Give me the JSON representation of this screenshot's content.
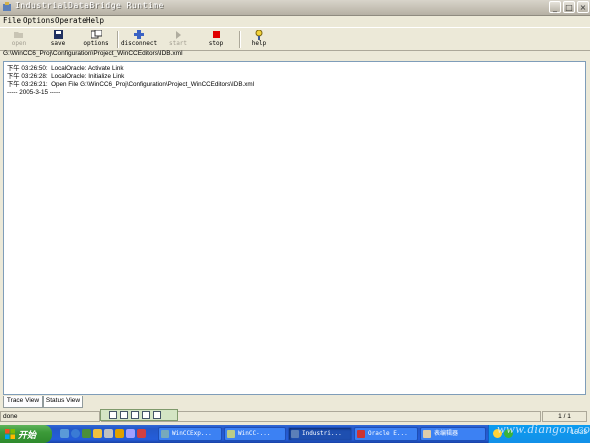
{
  "window": {
    "title": "IndustrialDataBridge Runtime",
    "controls": {
      "minimize": "_",
      "maximize": "□",
      "close": "×"
    }
  },
  "menu": [
    "File",
    "Options",
    "Operate",
    "Help"
  ],
  "toolbar": [
    {
      "label": "open",
      "icon": "open-folder-icon",
      "enabled": false
    },
    {
      "label": "save",
      "icon": "floppy-disk-icon",
      "enabled": true
    },
    {
      "label": "options",
      "icon": "options-window-icon",
      "enabled": true
    },
    {
      "label": "disconnect",
      "icon": "disconnect-plug-icon",
      "enabled": true
    },
    {
      "label": "start",
      "icon": "play-arrow-icon",
      "enabled": false
    },
    {
      "label": "stop",
      "icon": "red-stop-square-icon",
      "enabled": true
    },
    {
      "label": "help",
      "icon": "help-question-icon",
      "enabled": true
    }
  ],
  "file_path": "G:\\WinCC6_Proj\\Configuration\\Project_WinCCEditors\\IDB.xml",
  "log": [
    "下午 03:26:50:  LocalOracle: Activate Link",
    "下午 03:26:28:  LocalOracle: Initialize Link",
    "下午 03:26:21:  Open File G:\\WinCC6_Proj\\Configuration\\Project_WinCCEditors\\IDB.xml",
    "----- 2005-3-15 -----"
  ],
  "tabs": [
    "Trace View",
    "Status View"
  ],
  "status": {
    "left": "done",
    "page": "1 / 1"
  },
  "taskbar": {
    "start": "开始",
    "tasks": [
      "WinCCExp...",
      "WinCC-...",
      "Industri...",
      "Oracle E...",
      "表编辑器"
    ],
    "clock": "15:33"
  },
  "watermark": "www.diangon.com",
  "colors": {
    "taskbar": "#245dda",
    "start": "#3c9a39",
    "stop": "#e00000",
    "log_border": "#7f9db9"
  }
}
